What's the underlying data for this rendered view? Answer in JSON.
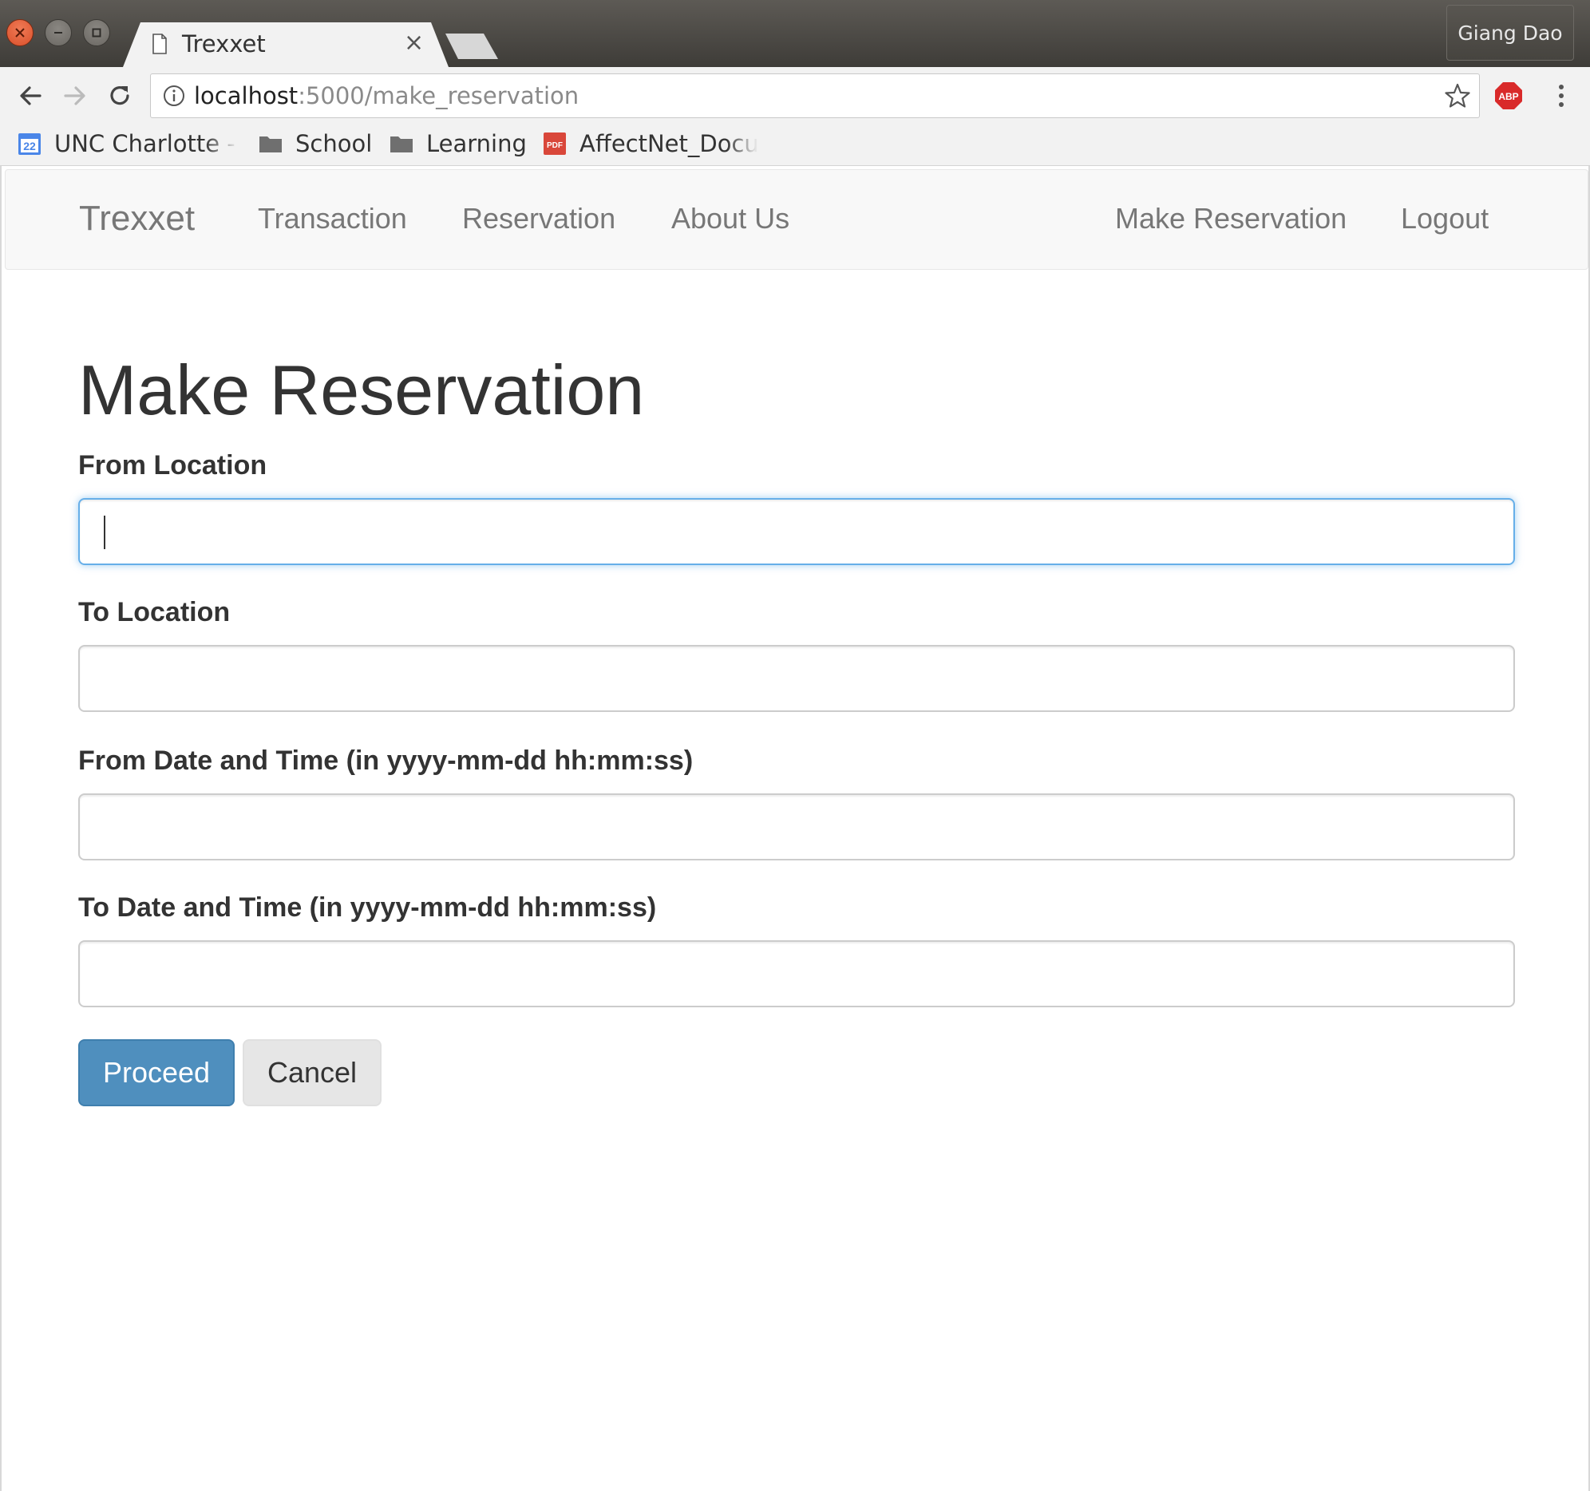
{
  "browser": {
    "tab_title": "Trexxet",
    "tab_close_glyph": "×",
    "profile_name": "Giang Dao",
    "url_host": "localhost",
    "url_path": ":5000/make_reservation",
    "bookmarks": [
      {
        "label": "UNC Charlotte - C",
        "icon": "calendar-icon"
      },
      {
        "label": "School",
        "icon": "folder-icon"
      },
      {
        "label": "Learning",
        "icon": "folder-icon"
      },
      {
        "label": "AffectNet_Docu",
        "icon": "pdf-icon"
      }
    ],
    "calendar_day": "22",
    "pdf_text": "PDF",
    "abp_text": "ABP"
  },
  "navbar": {
    "brand": "Trexxet",
    "links": [
      "Transaction",
      "Reservation",
      "About Us"
    ],
    "right_links": [
      "Make Reservation",
      "Logout"
    ]
  },
  "form": {
    "title": "Make Reservation",
    "fields": [
      {
        "label": "From Location",
        "value": ""
      },
      {
        "label": "To Location",
        "value": ""
      },
      {
        "label": "From Date and Time (in yyyy-mm-dd hh:mm:ss)",
        "value": ""
      },
      {
        "label": "To Date and Time (in yyyy-mm-dd hh:mm:ss)",
        "value": ""
      }
    ],
    "proceed_label": "Proceed",
    "cancel_label": "Cancel"
  },
  "colors": {
    "primary": "#4f8fbe",
    "focus": "#66afe9",
    "navbar_bg": "#f8f8f8",
    "chrome_dark": "#3e3c38"
  }
}
